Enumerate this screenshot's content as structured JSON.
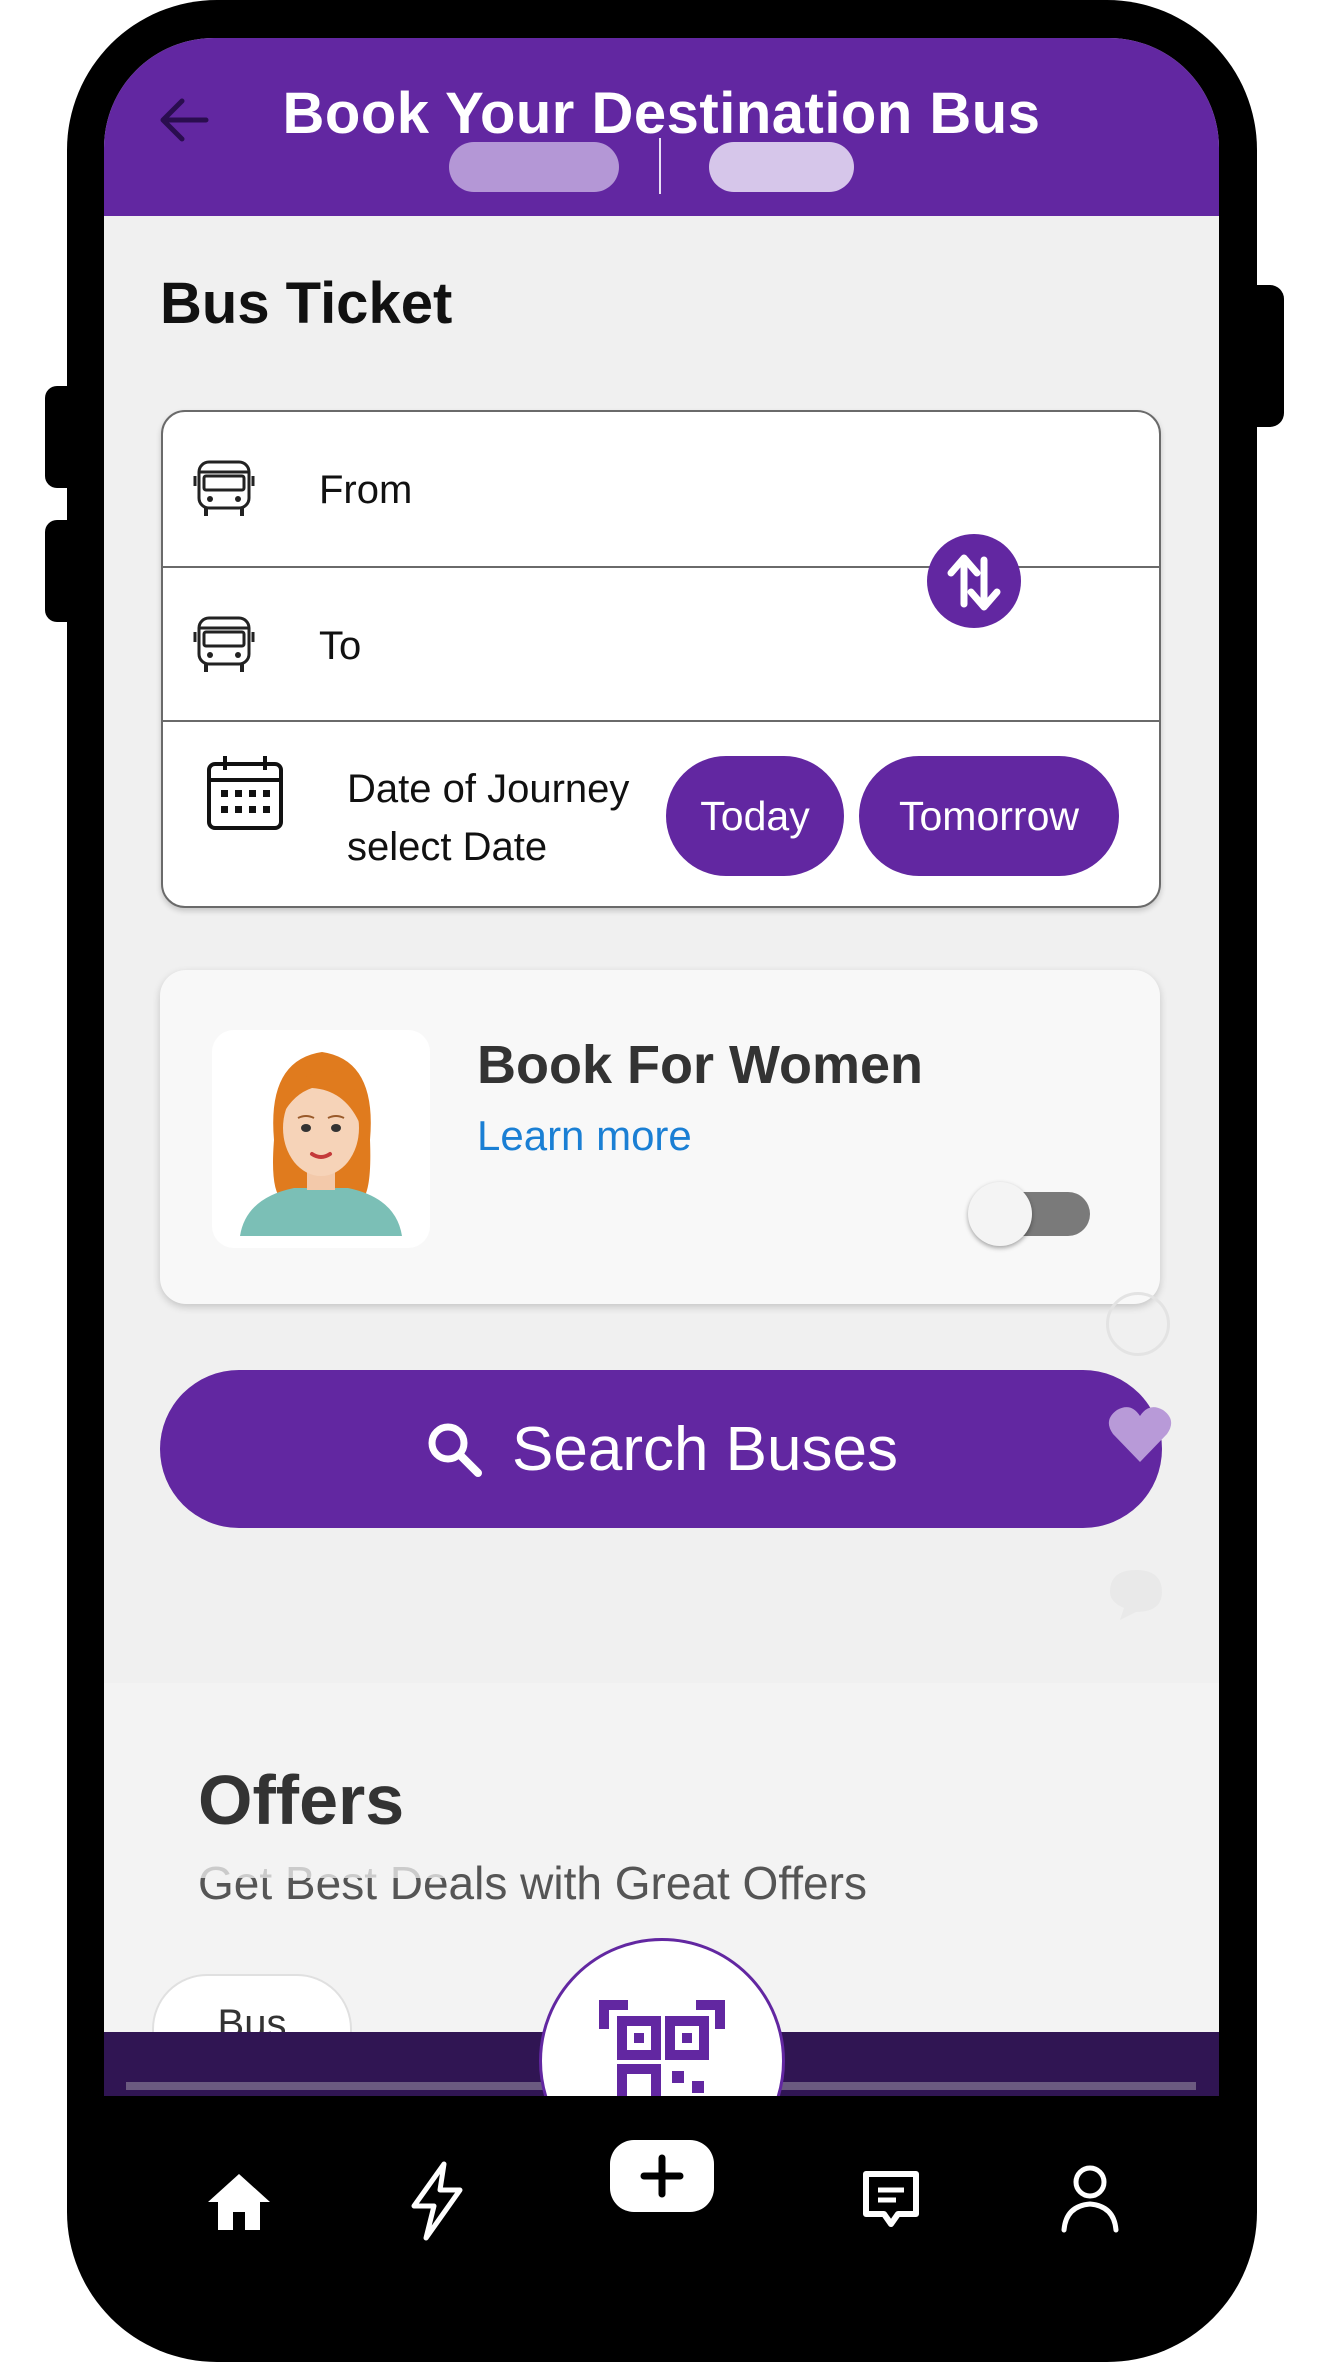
{
  "header": {
    "title": "Book Your Destination Bus",
    "back_icon": "arrow-left-icon"
  },
  "section": {
    "title": "Bus Ticket"
  },
  "booking": {
    "from_label": "From",
    "to_label": "To",
    "date_line1": "Date of Journey",
    "date_line2": "select Date",
    "today_label": "Today",
    "tomorrow_label": "Tomorrow"
  },
  "women": {
    "title": "Book For Women",
    "learn_more": "Learn more",
    "toggle_on": false
  },
  "search": {
    "label": "Search Buses"
  },
  "offers": {
    "title": "Offers",
    "subtitle": "Get Best Deals with Great Offers",
    "chips": [
      "Bus"
    ]
  },
  "colors": {
    "brand_purple": "#6227a1",
    "link_blue": "#1a7fd4"
  },
  "bottom_nav": [
    "home-icon",
    "bolt-icon",
    "add-icon",
    "chat-icon",
    "profile-icon"
  ]
}
